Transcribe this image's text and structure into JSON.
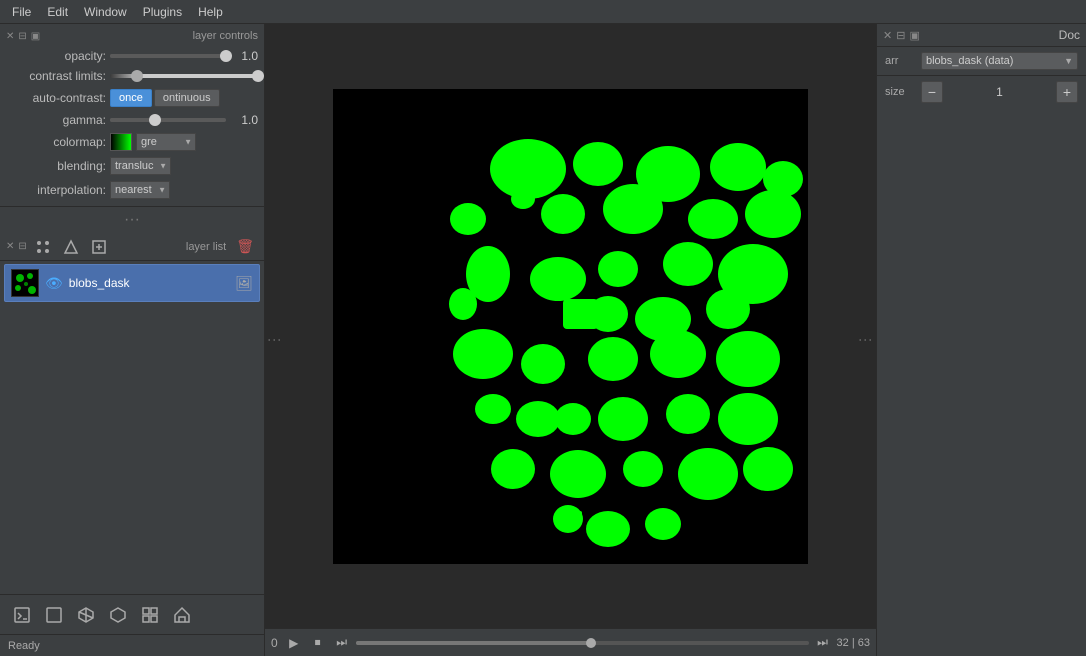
{
  "menubar": {
    "items": [
      "File",
      "Edit",
      "Window",
      "Plugins",
      "Help"
    ]
  },
  "layer_controls": {
    "title": "layer controls",
    "opacity": {
      "label": "opacity:",
      "value": "1.0",
      "percent": 100
    },
    "contrast": {
      "label": "contrast limits:",
      "low": 20,
      "high": 100
    },
    "auto_contrast": {
      "label": "auto-contrast:",
      "once_label": "once",
      "continuous_label": "ontinuous"
    },
    "gamma": {
      "label": "gamma:",
      "value": "1.0",
      "percent": 40
    },
    "colormap": {
      "label": "colormap:",
      "value": "gre"
    },
    "blending": {
      "label": "blending:",
      "value": "transluc"
    },
    "interpolation": {
      "label": "interpolation:",
      "value": "nearest"
    }
  },
  "layer_list": {
    "title": "layer list",
    "layers": [
      {
        "name": "blobs_dask",
        "visible": true,
        "selected": true
      }
    ]
  },
  "timeline": {
    "current_frame": "32",
    "total_frames": "63",
    "position_label": "32 | 63"
  },
  "right_panel": {
    "title": "Doc",
    "arr_label": "arr",
    "arr_value": "blobs_dask (data)",
    "size_label": "size",
    "size_value": "1"
  },
  "statusbar": {
    "text": "Ready"
  },
  "bottom_tools": [
    {
      "name": "console",
      "symbol": "⬛"
    },
    {
      "name": "2d-view",
      "symbol": "⬜"
    },
    {
      "name": "3d-transform",
      "symbol": "◈"
    },
    {
      "name": "ndisplay",
      "symbol": "⬡"
    },
    {
      "name": "grid",
      "symbol": "⊞"
    },
    {
      "name": "home",
      "symbol": "⌂"
    }
  ]
}
